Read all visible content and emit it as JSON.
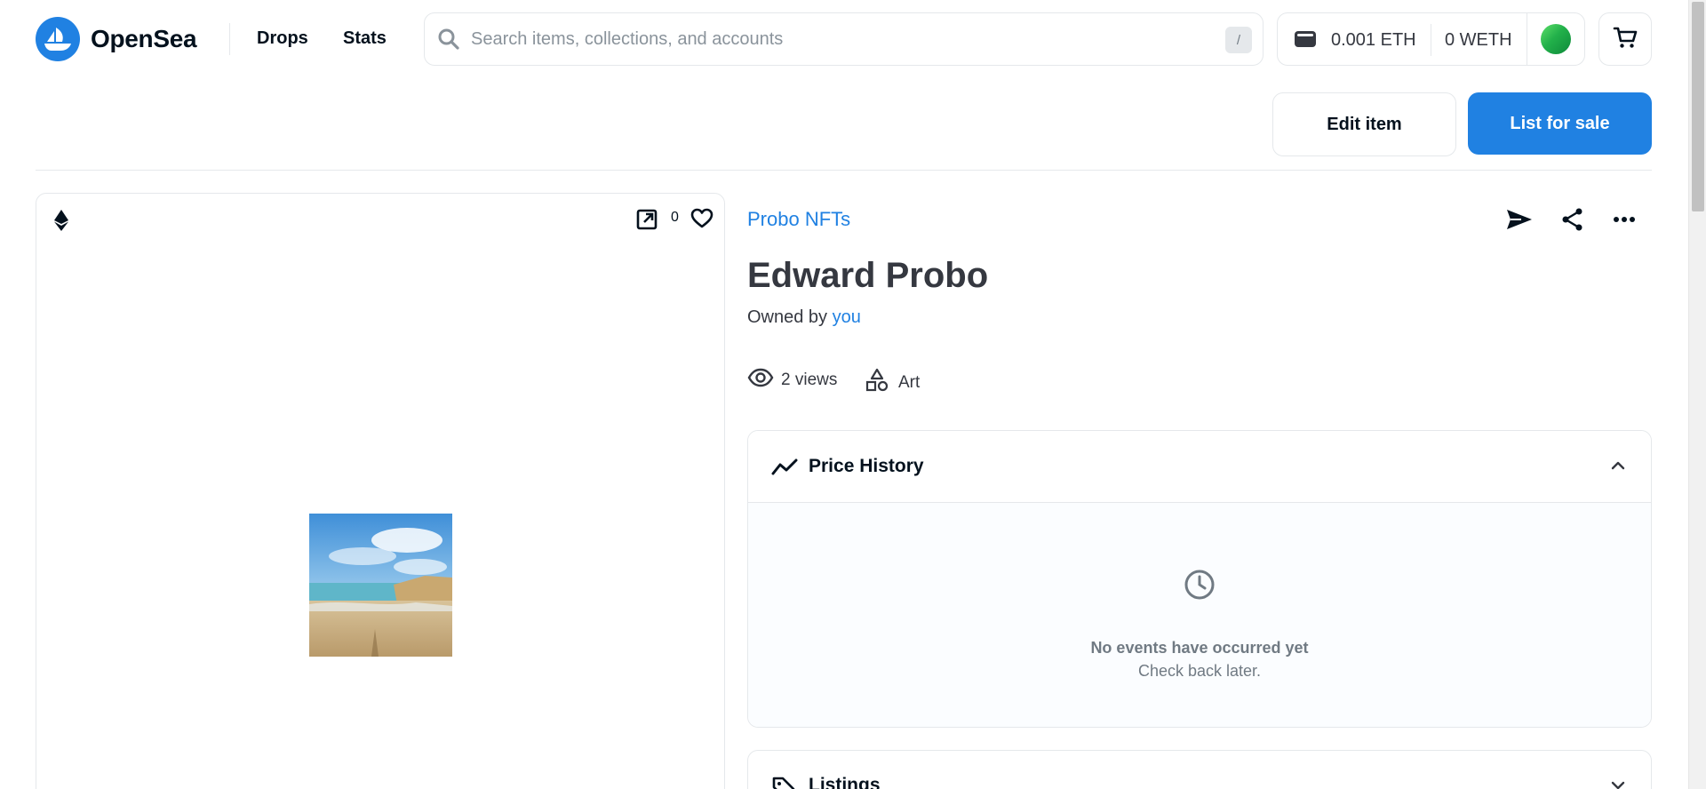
{
  "nav": {
    "brand": "OpenSea",
    "links": [
      "Drops",
      "Stats"
    ],
    "search_placeholder": "Search items, collections, and accounts",
    "search_shortcut": "/",
    "wallet": {
      "eth_balance": "0.001 ETH",
      "weth_balance": "0 WETH"
    }
  },
  "actions": {
    "edit_label": "Edit item",
    "list_label": "List for sale"
  },
  "media": {
    "favorites_count": "0"
  },
  "item": {
    "collection": "Probo NFTs",
    "title": "Edward Probo",
    "owned_prefix": "Owned by",
    "owner": "you",
    "views": "2 views",
    "category": "Art"
  },
  "price_history": {
    "title": "Price History",
    "empty_title": "No events have occurred yet",
    "empty_subtitle": "Check back later."
  },
  "listings": {
    "title": "Listings"
  },
  "colors": {
    "accent": "#2081e2",
    "text": "#04111d",
    "muted": "#707a83",
    "border": "#e5e8eb"
  }
}
